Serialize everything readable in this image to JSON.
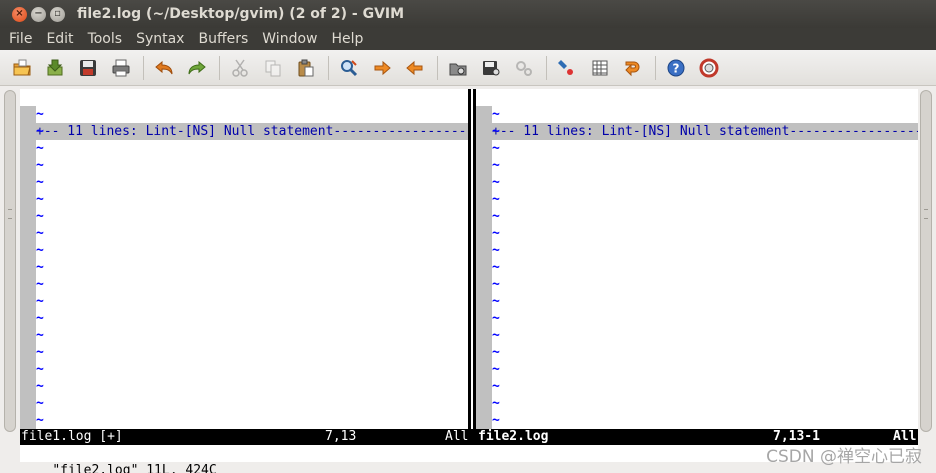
{
  "window": {
    "title": "file2.log (~/Desktop/gvim) (2 of 2) - GVIM",
    "close_glyph": "×",
    "minimize_glyph": "−",
    "maximize_glyph": "▫"
  },
  "menu": [
    "File",
    "Edit",
    "Tools",
    "Syntax",
    "Buffers",
    "Window",
    "Help"
  ],
  "toolbar": [
    {
      "name": "open-icon",
      "enabled": true
    },
    {
      "name": "save-icon",
      "enabled": true
    },
    {
      "name": "save-all-icon",
      "enabled": true
    },
    {
      "name": "print-icon",
      "enabled": true
    },
    {
      "name": "undo-icon",
      "enabled": true
    },
    {
      "name": "redo-icon",
      "enabled": true
    },
    {
      "name": "cut-icon",
      "enabled": false
    },
    {
      "name": "copy-icon",
      "enabled": false
    },
    {
      "name": "paste-icon",
      "enabled": true
    },
    {
      "name": "find-replace-icon",
      "enabled": true
    },
    {
      "name": "find-next-icon",
      "enabled": true
    },
    {
      "name": "find-previous-icon",
      "enabled": true
    },
    {
      "name": "load-session-icon",
      "enabled": true
    },
    {
      "name": "save-session-icon",
      "enabled": true
    },
    {
      "name": "run-script-icon",
      "enabled": false
    },
    {
      "name": "make-icon",
      "enabled": true
    },
    {
      "name": "shell-icon",
      "enabled": true
    },
    {
      "name": "tags-jump-icon",
      "enabled": true
    },
    {
      "name": "help-icon",
      "enabled": true
    },
    {
      "name": "find-help-icon",
      "enabled": true
    }
  ],
  "left_pane": {
    "fold_marker": "+",
    "fold_text": "+-- 11 lines: Lint-[NS] Null statement-------------------",
    "tilde": "~",
    "status": {
      "name": "file1.log [+]",
      "position": "7,13",
      "scroll": "All"
    }
  },
  "right_pane": {
    "fold_marker": "+",
    "fold_text": "+-- 11 lines: Lint-[NS] Null statement-------------------",
    "tilde": "~",
    "status": {
      "name": "file2.log",
      "position": "7,13-1",
      "scroll": "All"
    }
  },
  "command_line": "\"file2.log\" 11L, 424C",
  "watermark": "CSDN @禅空心已寂",
  "colors": {
    "tilde": "#0000ff",
    "fold_text": "#0000aa",
    "fold_background": "#c0c0c0",
    "statusline": "#000000"
  }
}
